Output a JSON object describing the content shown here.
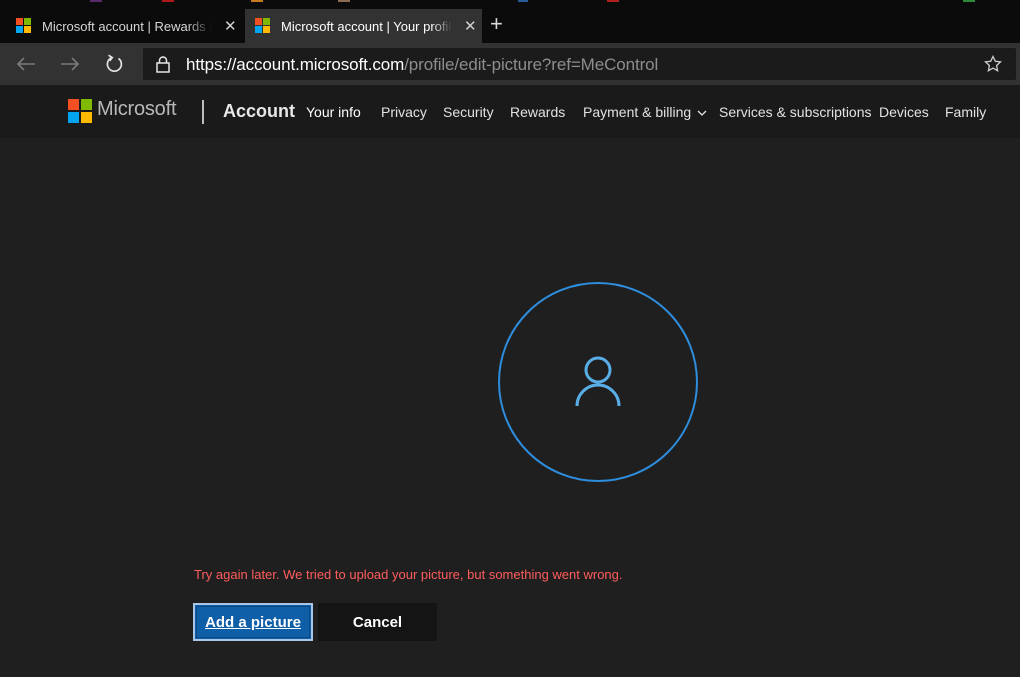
{
  "browser": {
    "tabs": [
      {
        "title": "Microsoft account | Rewards Dashboard",
        "active": false
      },
      {
        "title": "Microsoft account | Your profile | Microsoft account",
        "active": true
      }
    ],
    "new_tab_icon": "plus-icon",
    "close_icon": "close-icon",
    "url_host": "https://account.microsoft.com",
    "url_path": "/profile/edit-picture?ref=MeControl"
  },
  "header": {
    "brand": "Microsoft",
    "section": "Account",
    "nav": [
      {
        "label": "Your info",
        "active": true
      },
      {
        "label": "Privacy"
      },
      {
        "label": "Security"
      },
      {
        "label": "Rewards"
      },
      {
        "label": "Payment & billing",
        "has_dropdown": true
      },
      {
        "label": "Services & subscriptions"
      },
      {
        "label": "Devices"
      },
      {
        "label": "Family"
      }
    ]
  },
  "main": {
    "avatar_icon": "person-icon",
    "error": "Try again later. We tried to upload your picture, but something went wrong.",
    "add_button": "Add a picture",
    "cancel_button": "Cancel"
  },
  "colors": {
    "ms_red": "#f25022",
    "ms_green": "#7fba00",
    "ms_blue": "#00a4ef",
    "ms_yellow": "#ffb900",
    "accent": "#2e8ddc",
    "error": "#ff5c5c",
    "primary_button": "#0f5ea8"
  }
}
